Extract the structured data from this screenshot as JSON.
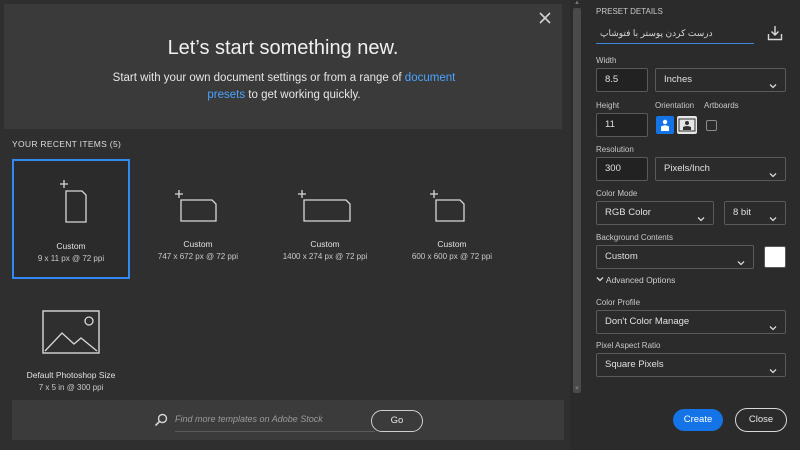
{
  "hero": {
    "title": "Let’s start something new.",
    "subtitle_before": "Start with your own document settings or from a range of ",
    "subtitle_link": "document presets",
    "subtitle_after": " to get working quickly.",
    "close_icon": "close-icon"
  },
  "recent": {
    "heading": "YOUR RECENT ITEMS  (5)",
    "items": [
      {
        "name": "Custom",
        "dims": "9 x 11 px @ 72 ppi",
        "icon": "document-icon",
        "selected": true
      },
      {
        "name": "Custom",
        "dims": "747 x 672 px @ 72 ppi",
        "icon": "document-icon",
        "selected": false
      },
      {
        "name": "Custom",
        "dims": "1400 x 274 px @ 72 ppi",
        "icon": "document-icon",
        "selected": false
      },
      {
        "name": "Custom",
        "dims": "600 x 600 px @ 72 ppi",
        "icon": "document-icon",
        "selected": false
      },
      {
        "name": "Default Photoshop Size",
        "dims": "7 x 5 in @ 300 ppi",
        "icon": "image-icon",
        "selected": false
      }
    ]
  },
  "search": {
    "placeholder": "Find more templates on Adobe Stock",
    "go_label": "Go"
  },
  "preset": {
    "section_label": "PRESET DETAILS",
    "name": "درست کردن پوستر با فتوشاپ",
    "width_label": "Width",
    "width_value": "8.5",
    "width_unit": "Inches",
    "height_label": "Height",
    "height_value": "11",
    "orientation_label": "Orientation",
    "artboards_label": "Artboards",
    "resolution_label": "Resolution",
    "resolution_value": "300",
    "resolution_unit": "Pixels/Inch",
    "color_mode_label": "Color Mode",
    "color_mode_value": "RGB Color",
    "bit_depth_value": "8 bit",
    "background_label": "Background Contents",
    "background_value": "Custom",
    "advanced_label": "Advanced Options",
    "color_profile_label": "Color Profile",
    "color_profile_value": "Don't Color Manage",
    "pixel_aspect_label": "Pixel Aspect Ratio",
    "pixel_aspect_value": "Square Pixels"
  },
  "actions": {
    "create_label": "Create",
    "close_label": "Close"
  },
  "colors": {
    "accent": "#1473e6",
    "link": "#4aa3ff",
    "selected_border": "#3389f3",
    "background_swatch": "#ffffff"
  }
}
